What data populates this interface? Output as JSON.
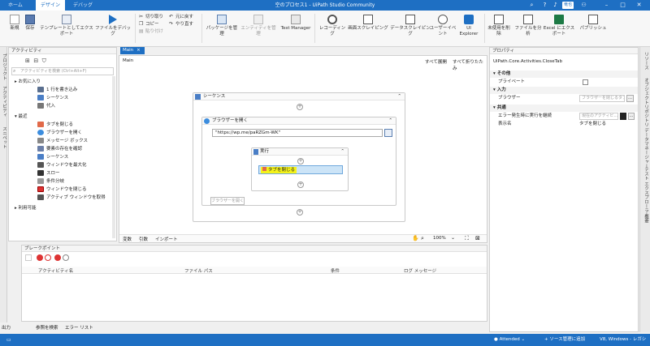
{
  "window": {
    "title": "空のプロセス1 - UiPath Studio Community",
    "tabs": [
      "ホーム",
      "デザイン",
      "デバッグ"
    ],
    "user": "竜也"
  },
  "ribbon": {
    "new": "新規",
    "save": "保存",
    "export_template": "テンプレートとしてエクスポート",
    "debug_file": "ファイルをデバッグ",
    "cut": "切り取り",
    "copy": "コピー",
    "paste": "貼り付け",
    "undo": "元に戻す",
    "redo": "やり直す",
    "manage_packages": "パッケージを管理",
    "manage_entities": "エンティティを管理",
    "test_manager": "Test Manager",
    "recording": "レコーディング",
    "screen_scraping": "画面スクレイピング",
    "data_scraping": "データスクレイピング",
    "user_events": "ユーザーイベント",
    "ui_explorer": "UI Explorer",
    "remove_unused": "未使用を削除",
    "analyze_file": "ファイルを分析",
    "excel_export": "Excel にエクスポート",
    "publish": "パブリッシュ"
  },
  "activities": {
    "panel_title": "アクティビティ",
    "search_placeholder": "アクティビティを検索 (Ctrl+Alt+F)",
    "favorites_label": "お気に入り",
    "favorites": [
      "1 行を書き込み",
      "シーケンス",
      "代入"
    ],
    "recent_label": "最近",
    "recent": [
      "タブを閉じる",
      "ブラウザーを開く",
      "メッセージ ボックス",
      "要素の存在を確認",
      "シーケンス",
      "ウィンドウを最大化",
      "スロー",
      "条件分岐",
      "ウィンドウを閉じる",
      "アクティブ ウィンドウを取得"
    ],
    "available_label": "利用可能"
  },
  "left_vertical_tabs": [
    "プロジェクト",
    "アクティビティ",
    "スニペット"
  ],
  "designer": {
    "tab": "Main",
    "breadcrumb": "Main",
    "expand_all": "すべて展開",
    "collapse_all": "すべて折りたたみ",
    "sequence_title": "シーケンス",
    "open_browser_title": "ブラウザーを開く",
    "url_value": "\"https://wp.me/paRZGm-WK\"",
    "do_title": "実行",
    "close_tab_label": "タブを閉じる",
    "drop_hint": "ブラウザーを開く",
    "bottom_tabs": [
      "変数",
      "引数",
      "インポート"
    ],
    "zoom": "100%"
  },
  "breakpoints": {
    "panel_title": "ブレークポイント",
    "columns": [
      "アクティビティ名",
      "ファイル パス",
      "条件",
      "ログ メッセージ"
    ]
  },
  "bottom_tabs": [
    "出力",
    "参照を検索",
    "エラー リスト"
  ],
  "properties": {
    "panel_title": "プロパティ",
    "class_name": "UiPath.Core.Activities.CloseTab",
    "sections": {
      "misc": "その他",
      "input": "入力",
      "common": "共通"
    },
    "private_label": "プライベート",
    "browser_label": "ブラウザー",
    "browser_placeholder": "ブラウザーを閉じるタブ",
    "continue_on_error_label": "エラー発生時に実行を継続",
    "continue_on_error_placeholder": "現在のアクティビ...",
    "display_name_label": "表示名",
    "display_name_value": "タブを閉じる"
  },
  "right_vertical_tabs": [
    "リソース",
    "オブジェクトリポジトリ",
    "データマネージャー",
    "テスト エクスプローラー",
    "概要"
  ],
  "statusbar": {
    "attended": "Attended",
    "add_source_control": "+ ソース管理に追加",
    "runtime": "V8, Windows - レガシ"
  },
  "colors": {
    "accent": "#1e6fc3",
    "selected_activity": "#cce4f7",
    "highlight_text": "#f5f31a"
  }
}
